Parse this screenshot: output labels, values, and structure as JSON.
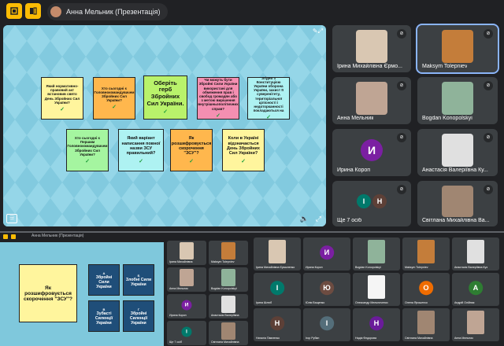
{
  "topbar": {
    "presenter_label": "Анна Мельник (Презентація)"
  },
  "stage_cards": [
    {
      "text": "Який нормативно-правовий акт встановив свято День Збройних Сил України?",
      "color": "#fff59d",
      "size": "small"
    },
    {
      "text": "Хто сьогодні є Головнокомандувачем Збройних Сил України?",
      "color": "#ffb74d",
      "size": "small"
    },
    {
      "text": "Оберіть герб Збройних Сил України.",
      "color": "#b9f26b",
      "size": "big"
    },
    {
      "text": "Чи можуть бути Збройні Сили України використані для обмеження прав і свобод громадян або з метою вирішення внутрішньополітичних справ?",
      "color": "#f48fb1",
      "size": "small"
    },
    {
      "text": "Згідно з Конституцією України оборона України, захист її суверенітету, територіальної цілісності і недоторканності покладаються на",
      "color": "#aef2f2",
      "size": "small"
    },
    {
      "text": "Хто сьогодні є Першим Головнокомандувачем Збройних Сил України?",
      "color": "#a5f5a0",
      "size": "small"
    },
    {
      "text": "Який варіант написання повної назви ЗСУ правильний?",
      "color": "#aef2f2",
      "size": "mid"
    },
    {
      "text": "Як розшифровується скорочення \"ЗСУ\"?",
      "color": "#ffb74d",
      "size": "mid"
    },
    {
      "text": "Коли в Україні відзначається День Збройних Сил України?",
      "color": "#fff59d",
      "size": "mid"
    }
  ],
  "check_mark": "✓",
  "participants": [
    {
      "name": "Ірина Михайлівна Єрмо...",
      "type": "photo",
      "color": "#d9c7b2"
    },
    {
      "name": "Maksym Tolepniev",
      "type": "photo",
      "color": "#c47d3a",
      "active": true
    },
    {
      "name": "Анна Мельник",
      "type": "photo",
      "color": "#bfa594"
    },
    {
      "name": "Bogdan Konopolskyi",
      "type": "photo",
      "color": "#8fb39a"
    },
    {
      "name": "Ирина Короп",
      "type": "avatar",
      "initial": "И",
      "color": "#7b1fa2"
    },
    {
      "name": "Анастасія Валеріївна Ку...",
      "type": "photo",
      "color": "#e0e0e0"
    },
    {
      "name": "Ще 7 осіб",
      "type": "more",
      "initials": [
        "І",
        "Н"
      ]
    },
    {
      "name": "Світлана Михайлівна Ва...",
      "type": "photo",
      "color": "#a08672"
    }
  ],
  "mini": {
    "title": "Анна Мельник (Презентація)",
    "main_card": "Як розшифровується скорочення \"ЗСУ\"?",
    "options": [
      "Збройні Сили України",
      "Злобні Сили України",
      "Зубасті Силенції України",
      "Збройні Силенції України"
    ],
    "option_letters": [
      "А",
      "Б",
      "В",
      "Г"
    ],
    "left_grid": [
      {
        "name": "Ірина Михайлівна",
        "type": "photo",
        "color": "#d9c7b2"
      },
      {
        "name": "Maksym Tolepniev",
        "type": "photo",
        "color": "#c47d3a"
      },
      {
        "name": "Анна Мельник",
        "type": "photo",
        "color": "#bfa594"
      },
      {
        "name": "Bogdan Konopolskyi",
        "type": "photo",
        "color": "#8fb39a"
      },
      {
        "name": "Ирина Короп",
        "type": "avatar",
        "initial": "И",
        "color": "#7b1fa2"
      },
      {
        "name": "Анастасія Валеріївна",
        "type": "photo",
        "color": "#e0e0e0"
      },
      {
        "name": "Ще 7 осіб",
        "type": "avatar",
        "initial": "І",
        "color": "#00796b"
      },
      {
        "name": "Світлана Михайлівна",
        "type": "photo",
        "color": "#a08672"
      }
    ],
    "right_grid": [
      {
        "name": "Ірина Михайлівна Єрмоленко",
        "type": "photo",
        "color": "#d9c7b2"
      },
      {
        "name": "Ирина Короп",
        "type": "avatar",
        "initial": "И",
        "color": "#7b1fa2"
      },
      {
        "name": "Bogdan Konopolskyi",
        "type": "photo",
        "color": "#8fb39a"
      },
      {
        "name": "Maksym Tolepniev",
        "type": "photo",
        "color": "#c47d3a"
      },
      {
        "name": "Анастасія Валеріївна Куз",
        "type": "photo",
        "color": "#e0e0e0"
      },
      {
        "name": "Ірина Шлюб",
        "type": "avatar",
        "initial": "І",
        "color": "#00796b"
      },
      {
        "name": "Юлія Ващенко",
        "type": "avatar",
        "initial": "Ю",
        "color": "#6d4c41"
      },
      {
        "name": "Олександр Мельниченко",
        "type": "photo",
        "color": "#f5f5f5"
      },
      {
        "name": "Олена Ярошенко",
        "type": "avatar",
        "initial": "О",
        "color": "#ef6c00"
      },
      {
        "name": "Андрій Олійник",
        "type": "avatar",
        "initial": "А",
        "color": "#2e7d32"
      },
      {
        "name": "Наталія Павленко",
        "type": "avatar",
        "initial": "Н",
        "color": "#5d4037"
      },
      {
        "name": "Ігор Рубан",
        "type": "avatar",
        "initial": "І",
        "color": "#546e7a"
      },
      {
        "name": "Надія Федорова",
        "type": "avatar",
        "initial": "Н",
        "color": "#6a1b9a"
      },
      {
        "name": "Світлана Михайлівна",
        "type": "photo",
        "color": "#a08672"
      },
      {
        "name": "Анна Мельник",
        "type": "photo",
        "color": "#bfa594"
      }
    ]
  }
}
